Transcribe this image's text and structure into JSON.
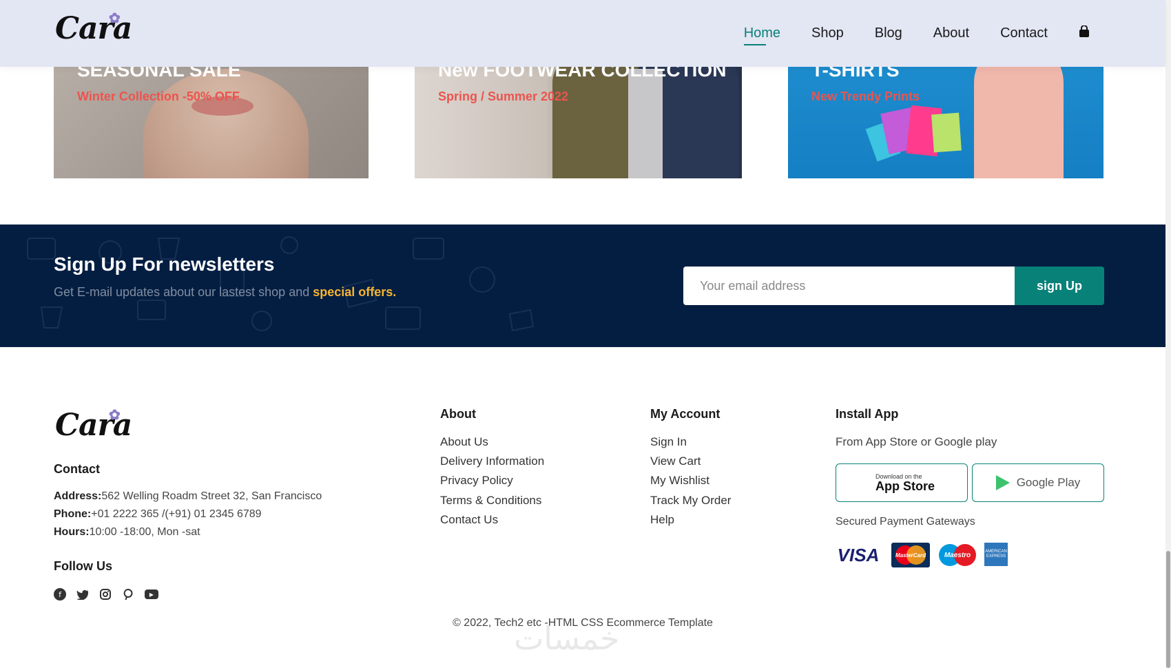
{
  "header": {
    "logo": "Cara",
    "nav": [
      "Home",
      "Shop",
      "Blog",
      "About",
      "Contact"
    ],
    "active": "Home"
  },
  "banners": [
    {
      "title": "SEASONAL SALE",
      "subtitle": "Winter Collection -50% OFF"
    },
    {
      "title": "New FOOTWEAR COLLECTION",
      "subtitle": "Spring / Summer 2022"
    },
    {
      "title": "T-SHIRTS",
      "subtitle": "New Trendy Prints"
    }
  ],
  "newsletter": {
    "title": "Sign Up For newsletters",
    "text": "Get E-mail updates about our lastest shop and",
    "highlight": "special offers.",
    "placeholder": "Your email address",
    "button": "sign Up"
  },
  "footer": {
    "logo": "Cara",
    "contact": {
      "heading": "Contact",
      "address_label": "Address:",
      "address": "562 Welling Roadm Street 32, San Francisco",
      "phone_label": "Phone:",
      "phone": "+01 2222 365 /(+91) 01 2345 6789",
      "hours_label": "Hours:",
      "hours": "10:00 -18:00, Mon -sat"
    },
    "follow": {
      "heading": "Follow Us",
      "icons": [
        "facebook-icon",
        "twitter-icon",
        "instagram-icon",
        "pinterest-icon",
        "youtube-icon"
      ]
    },
    "about": {
      "heading": "About",
      "links": [
        "About Us",
        "Delivery Information",
        "Privacy Policy",
        "Terms & Conditions",
        "Contact Us"
      ]
    },
    "account": {
      "heading": "My Account",
      "links": [
        "Sign In",
        "View Cart",
        "My Wishlist",
        "Track My Order",
        "Help"
      ]
    },
    "app": {
      "heading": "Install App",
      "text": "From App Store or Google play",
      "appstore_small": "Download on the",
      "appstore_big": "App Store",
      "googleplay": "Google Play",
      "payments_label": "Secured Payment Gateways",
      "payments": [
        "VISA",
        "MasterCard",
        "Maestro",
        "AMERICAN EXPRESS"
      ]
    },
    "copyright": "© 2022, Tech2 etc -HTML CSS Ecommerce Template",
    "watermark": "خمسات"
  },
  "colors": {
    "accent": "#088178",
    "header_bg": "#e3e6f3",
    "newsletter_bg": "#041e42",
    "highlight": "#f7b52f",
    "sale_red": "#ec544e"
  }
}
